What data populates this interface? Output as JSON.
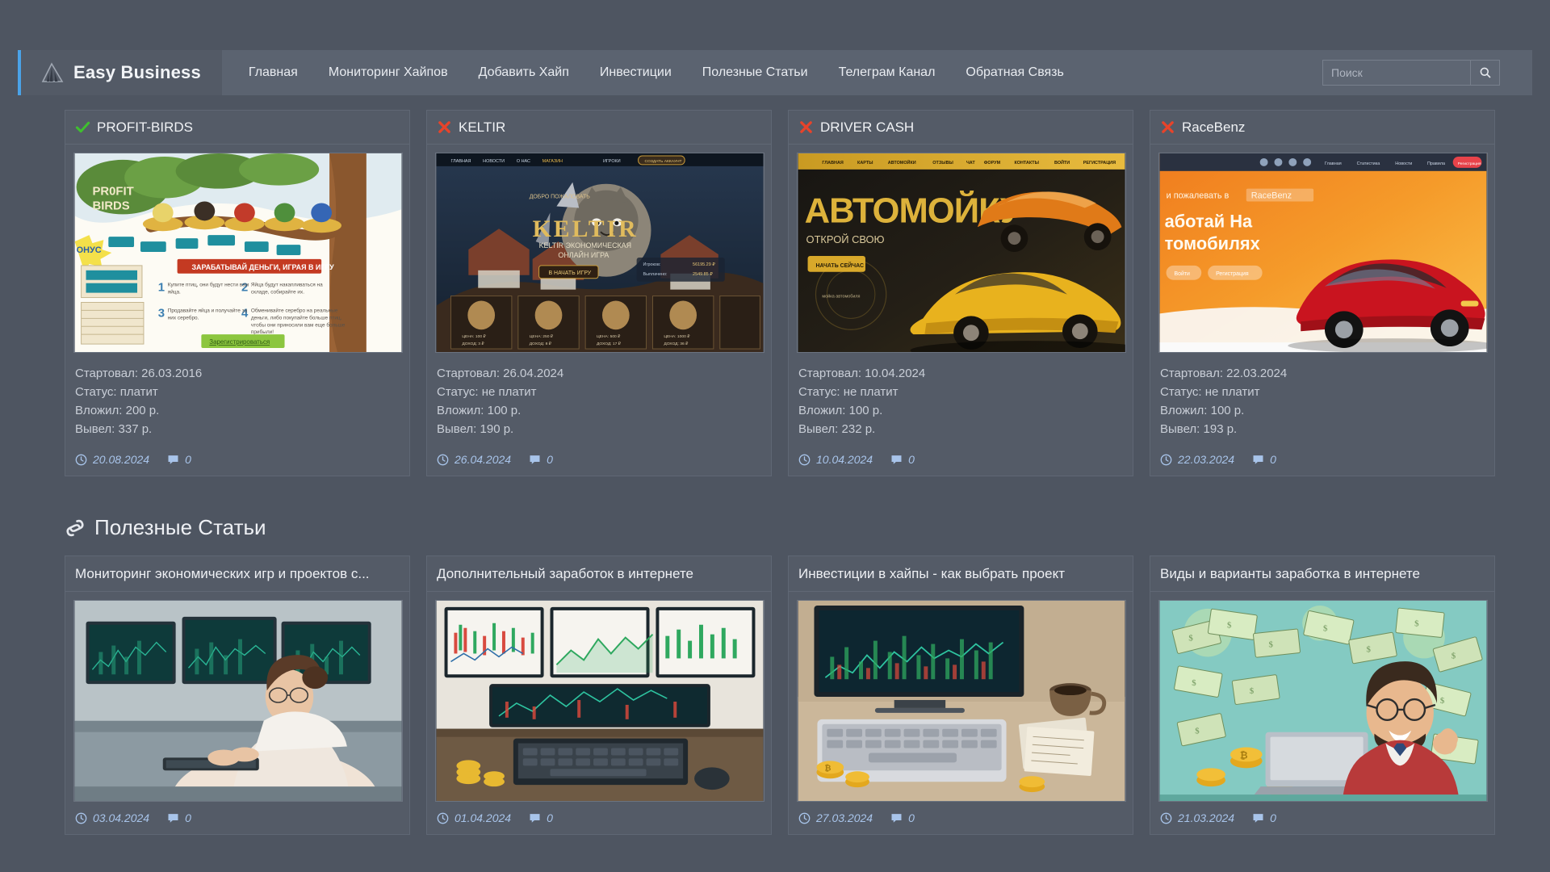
{
  "brand": {
    "name": "Easy Business",
    "logo_icon": "mountain-chart-icon",
    "accent_color": "#4aa3e8"
  },
  "nav": {
    "items": [
      {
        "label": "Главная"
      },
      {
        "label": "Мониторинг Хайпов"
      },
      {
        "label": "Добавить Хайп"
      },
      {
        "label": "Инвестиции"
      },
      {
        "label": "Полезные Статьи"
      },
      {
        "label": "Телеграм Канал"
      },
      {
        "label": "Обратная Связь"
      }
    ]
  },
  "search": {
    "placeholder": "Поиск",
    "value": "",
    "icon": "search-icon"
  },
  "hyip_cards": [
    {
      "title": "PROFIT-BIRDS",
      "status_icon": "green-check-icon",
      "started": "Стартовал: 26.03.2016",
      "status": "Статус: платит",
      "invested": "Вложил: 200 р.",
      "withdrawn": "Вывел: 337 р.",
      "date": "20.08.2024",
      "comments": "0"
    },
    {
      "title": "KELTIR",
      "status_icon": "red-cross-icon",
      "started": "Стартовал: 26.04.2024",
      "status": "Статус: не платит",
      "invested": "Вложил: 100 р.",
      "withdrawn": "Вывел: 190 р.",
      "date": "26.04.2024",
      "comments": "0"
    },
    {
      "title": "DRIVER CASH",
      "status_icon": "red-cross-icon",
      "started": "Стартовал: 10.04.2024",
      "status": "Статус: не платит",
      "invested": "Вложил: 100 р.",
      "withdrawn": "Вывел: 232 р.",
      "date": "10.04.2024",
      "comments": "0"
    },
    {
      "title": "RaceBenz",
      "status_icon": "red-cross-icon",
      "started": "Стартовал: 22.03.2024",
      "status": "Статус: не платит",
      "invested": "Вложил: 100 р.",
      "withdrawn": "Вывел: 193 р.",
      "date": "22.03.2024",
      "comments": "0"
    }
  ],
  "articles_section": {
    "heading": "Полезные Статьи",
    "icon": "link-chain-icon"
  },
  "articles": [
    {
      "title": "Мониторинг экономических игр и проектов с...",
      "date": "03.04.2024",
      "comments": "0"
    },
    {
      "title": "Дополнительный заработок в интернете",
      "date": "01.04.2024",
      "comments": "0"
    },
    {
      "title": "Инвестиции в хайпы - как выбрать проект",
      "date": "27.03.2024",
      "comments": "0"
    },
    {
      "title": "Виды и варианты заработка в интернете",
      "date": "21.03.2024",
      "comments": "0"
    }
  ]
}
